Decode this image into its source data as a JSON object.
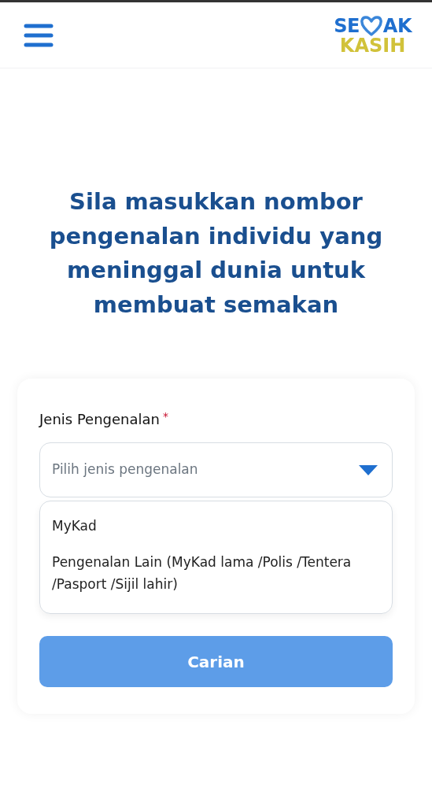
{
  "header": {
    "logo": {
      "left": "SE",
      "right": "AK",
      "line_2": "KASIH"
    }
  },
  "title": "Sila masukkan nombor pengenalan individu yang meninggal dunia untuk membuat semakan",
  "form": {
    "label": "Jenis Pengenalan",
    "required_mark": "*",
    "select": {
      "placeholder": "Pilih jenis pengenalan",
      "expanded": true
    },
    "options": [
      {
        "label": "MyKad",
        "selected": false
      },
      {
        "label": "Pengenalan Lain (MyKad lama /Polis /Tentera /Pasport /Sijil lahir)",
        "selected": false
      }
    ],
    "button": {
      "label": "Carian",
      "disabled": true
    }
  }
}
